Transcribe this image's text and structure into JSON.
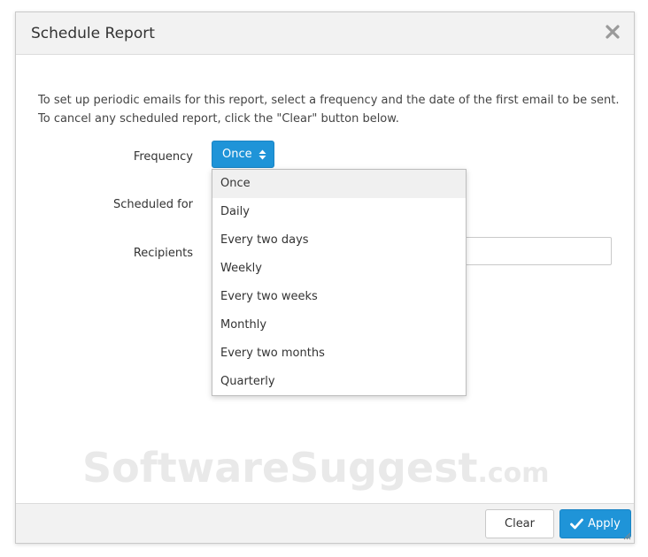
{
  "dialog": {
    "title": "Schedule Report",
    "close_icon": "close-icon"
  },
  "intro_text": "To set up periodic emails for this report, select a frequency and the date of the first email to be sent. To cancel any scheduled report, click the \"Clear\" button below.",
  "form": {
    "frequency_label": "Frequency",
    "frequency_value": "Once",
    "scheduled_label": "Scheduled for",
    "recipients_label": "Recipients",
    "recipients_value": ""
  },
  "frequency_options": [
    "Once",
    "Daily",
    "Every two days",
    "Weekly",
    "Every two weeks",
    "Monthly",
    "Every two months",
    "Quarterly"
  ],
  "selected_option": "Once",
  "footer": {
    "clear_label": "Clear",
    "apply_label": "Apply"
  },
  "watermark": {
    "main": "SoftwareSuggest",
    "suffix": ".com"
  },
  "colors": {
    "accent": "#1f94d8",
    "header_bg": "#f2f2f2",
    "selected_item_bg": "#f0f0f0"
  },
  "icons": {
    "close": "close-icon",
    "select_arrows": "updown-icon",
    "apply": "check-icon",
    "resize": "resize-grip-icon"
  }
}
